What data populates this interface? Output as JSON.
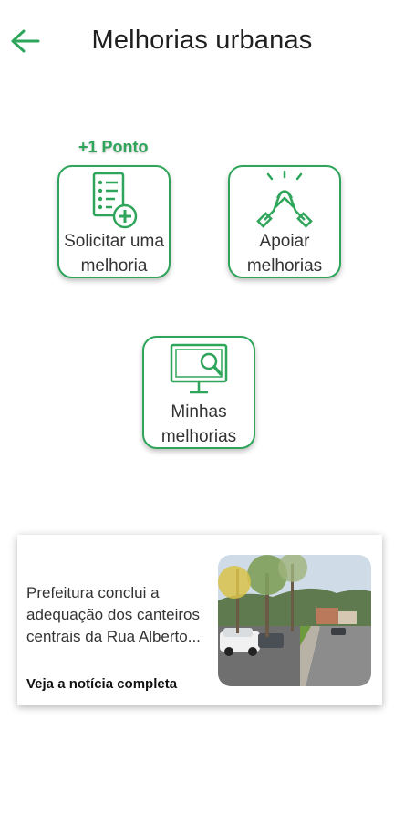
{
  "header": {
    "title": "Melhorias urbanas",
    "back_icon": "arrow-left-icon"
  },
  "colors": {
    "accent": "#2ea55a",
    "text": "#333333",
    "card_border": "#2ea55a"
  },
  "badge": {
    "points_label": "+1 Ponto"
  },
  "actions": [
    {
      "line1": "Solicitar uma",
      "line2": "melhoria",
      "icon": "request-list-add-icon"
    },
    {
      "line1": "Apoiar",
      "line2": "melhorias",
      "icon": "handshake-icon"
    },
    {
      "line1": "Minhas",
      "line2": "melhorias",
      "icon": "monitor-search-icon"
    }
  ],
  "news": {
    "text": "Prefeitura conclui a adequação dos canteiros centrais da Rua Alberto...",
    "link_label": "Veja a notícia completa"
  }
}
